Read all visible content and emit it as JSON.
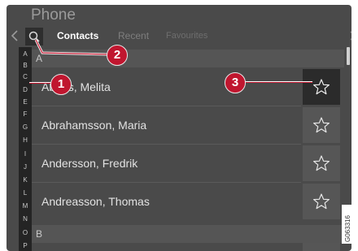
{
  "app": {
    "title": "Phone"
  },
  "tabs": [
    {
      "label": "Contacts",
      "state": "active"
    },
    {
      "label": "Recent",
      "state": "inactive"
    },
    {
      "label": "Favourites",
      "state": "dimmed"
    }
  ],
  "alphabet": [
    "A",
    "B",
    "C",
    "D",
    "E",
    "F",
    "G",
    "H",
    "I",
    "J",
    "K",
    "L",
    "M",
    "N",
    "O",
    "P"
  ],
  "sections": [
    {
      "letter": "A"
    },
    {
      "letter": "B"
    }
  ],
  "contacts": [
    {
      "name": "Abbas, Melita",
      "favourite_selected": true
    },
    {
      "name": "Abrahamsson, Maria",
      "favourite_selected": false
    },
    {
      "name": "Andersson, Fredrik",
      "favourite_selected": false
    },
    {
      "name": "Andreasson, Thomas",
      "favourite_selected": false
    }
  ],
  "callouts": [
    "1",
    "2",
    "3"
  ],
  "figure_code": "G063316",
  "icons": {
    "back": "chevron-left-icon",
    "search": "search-icon",
    "favourite": "star-outline-icon"
  },
  "colors": {
    "screen_bg": "#4a4a4a",
    "alphabet_bar": "#242424",
    "callout": "#c0162f",
    "active_star_bg": "#2b2b2b"
  }
}
